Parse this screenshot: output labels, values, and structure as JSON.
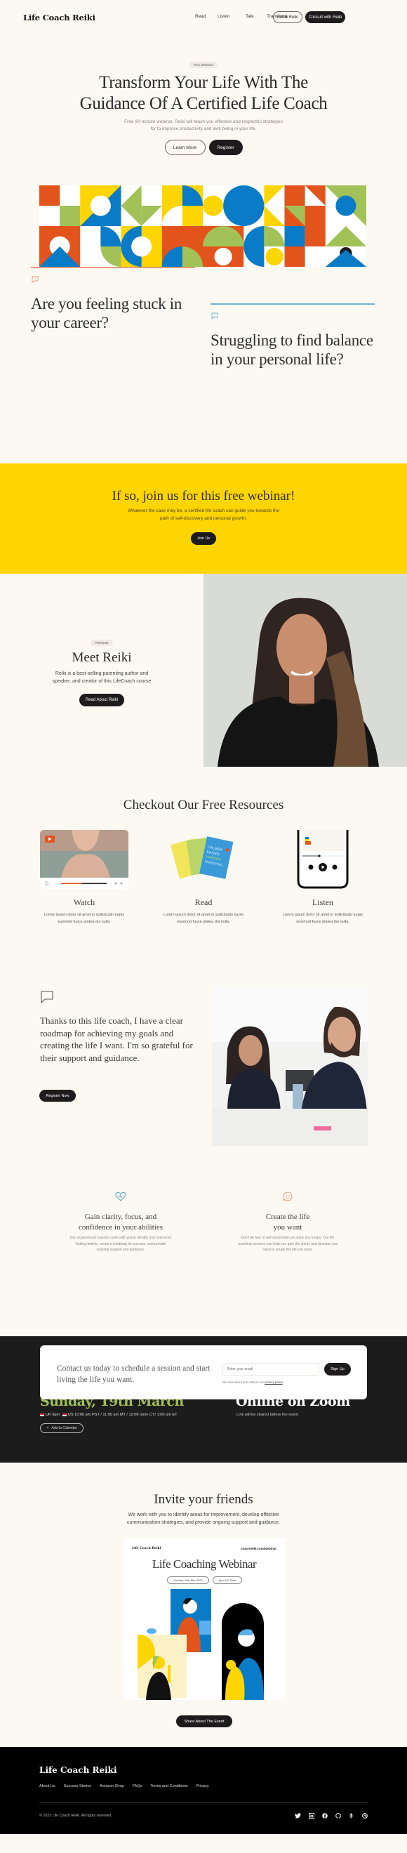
{
  "header": {
    "logo": "Life Coach Reiki",
    "nav": [
      "Read",
      "Listen",
      "Talk",
      "Transform"
    ],
    "know_button": "Know Reiki",
    "consult_button": "Consult with Reiki"
  },
  "hero": {
    "badge": "Free Webinar!",
    "title_line1": "Transform Your Life With The",
    "title_line2": "Guidance Of A Certified Life Coach",
    "subtitle_line1": "Free 90-minute webinar, Reiki will teach you effective and respectful strategies",
    "subtitle_line2": "for to improve productivity and well being in your life.",
    "learn_more": "Learn More",
    "register": "Register"
  },
  "colors": {
    "background": "#fcf9f2",
    "orange": "#e2541b",
    "yellow": "#fed500",
    "blue": "#0a7bc6",
    "green": "#a2c257",
    "dark": "#1d1b1b"
  },
  "questions": [
    {
      "title": "Are you feeling stuck in your career?",
      "line_color": "#e39a7a",
      "icon": "question-bubble-icon"
    },
    {
      "title": "Struggling to find balance in your personal life?",
      "line_color": "#6fb4cc",
      "icon": "question-bubble-icon"
    }
  ],
  "cta_band": {
    "title": "If so, join us for this free webinar!",
    "text_line1": "Whatever the case may be, a certified life coach can guide you towards the",
    "text_line2": "path of self-discovery and personal growth.",
    "button": "Join Us"
  },
  "presenter": {
    "badge": "Presenter",
    "title": "Meet Reiki",
    "text_line1": "Reiki is a best-selling parenting author and",
    "text_line2": "speaker, and creator of this LifeCoach course",
    "button": "Read About Reiki"
  },
  "resources": {
    "title": "Checkout Our Free Resources",
    "items": [
      {
        "title": "Watch",
        "text_line1": "Lorem ipsum dolor sit amet in sollicitudin turpis",
        "text_line2": "euismod fusce platea dui nulla."
      },
      {
        "title": "Read",
        "text_line1": "Lorem ipsum dolor sit amet in sollicitudin turpis",
        "text_line2": "euismod fusce platea dui nulla."
      },
      {
        "title": "Listen",
        "text_line1": "Lorem ipsum dolor sit amet in sollicitudin turpis",
        "text_line2": "euismod fusce platea dui nulla."
      }
    ],
    "book_text": "CALMER EASIER HAPPIER PARENTING"
  },
  "testimonial": {
    "quote": "Thanks to this life coach, I have a clear roadmap for achieving my goals and creating the life I want. I'm so grateful for their support and guidance.",
    "button": "Register Now"
  },
  "benefits": [
    {
      "icon": "heart-pulse-icon",
      "title_line1": "Gain clarity, focus, and",
      "title_line2": "confidence in your abilities",
      "text_line1": "Our experienced coaches work with you to identify and overcome",
      "text_line2": "limiting beliefs, create a roadmap for success, and provide",
      "text_line3": "ongoing support and guidance."
    },
    {
      "icon": "smile-bubble-icon",
      "title_line1": "Create the life",
      "title_line2": "you want",
      "text_line1": "Don't let fear or self-doubt hold you back any longer. Our life",
      "text_line2": "coaching services can help you gain the clarity and direction you",
      "text_line3": "need to create the life you want."
    }
  ],
  "contact": {
    "text": "Contact us today to schedule a session and start living the life you want.",
    "email_placeholder": "Enter your email",
    "signup": "Sign Up",
    "note": "We care about your data in our",
    "privacy_link": "privacy policy"
  },
  "event": {
    "date": "Sunday, 19th March",
    "times_uk": "UK 6pm",
    "times_us": "US 10:00 am PST / 11:00 am MT / 12:00 noon CT/ 1:00 pm ET",
    "add_calendar": "Add to Calendar",
    "location": "Online on Zoom",
    "location_note": "Link will be shared before the event"
  },
  "invite": {
    "title": "Invite your friends",
    "text_line1": "We work with you to identify areas for improvement, develop effective",
    "text_line2": "communication strategies, and provide ongoing support and guidance.",
    "poster": {
      "logo": "Life Coach Reiki",
      "url": "coachreiki.com/webinar",
      "title": "Life Coaching Webinar",
      "date_pill": "Sunday, 19th Mar 2023",
      "time_pill": "6pm UK Time"
    },
    "share_button": "Share About The Event"
  },
  "footer": {
    "logo": "Life Coach Reiki",
    "links": [
      "About Us",
      "Success Stories",
      "Amazon Shop",
      "FAQs",
      "Terms and Conditions",
      "Privacy"
    ],
    "copyright": "© 2023 Life Coach Reiki. All rights reserved.",
    "social": [
      "twitter-icon",
      "linkedin-icon",
      "facebook-icon",
      "github-icon",
      "pyramid-icon",
      "dribbble-icon"
    ]
  }
}
